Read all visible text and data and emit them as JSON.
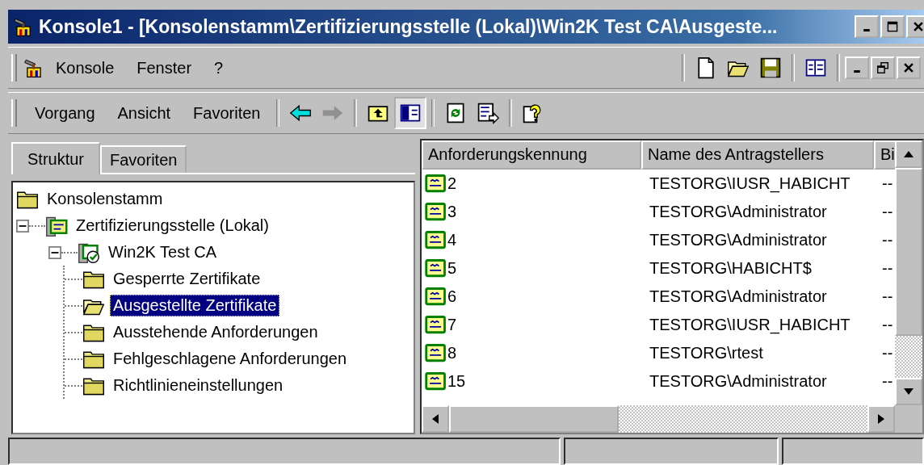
{
  "window": {
    "title": "Konsole1 - [Konsolenstamm\\Zertifizierungsstelle (Lokal)\\Win2K Test CA\\Ausgeste..."
  },
  "menu_bar": {
    "menus": [
      {
        "label": "Konsole"
      },
      {
        "label": "Fenster"
      },
      {
        "label": "?"
      }
    ],
    "tool_groups": [
      [
        {
          "kind": "new"
        },
        {
          "kind": "open"
        },
        {
          "kind": "save"
        }
      ],
      [
        {
          "kind": "panes"
        }
      ]
    ]
  },
  "action_bar": {
    "menus": [
      {
        "label": "Vorgang"
      },
      {
        "label": "Ansicht"
      },
      {
        "label": "Favoriten"
      }
    ],
    "tool_groups": [
      [
        {
          "kind": "back",
          "disabled": false
        },
        {
          "kind": "forward",
          "disabled": true
        }
      ],
      [
        {
          "kind": "up"
        },
        {
          "kind": "show-tree",
          "pressed": true
        }
      ],
      [
        {
          "kind": "refresh"
        },
        {
          "kind": "export"
        }
      ],
      [
        {
          "kind": "help"
        }
      ]
    ]
  },
  "tabs": [
    {
      "label": "Struktur",
      "selected": true
    },
    {
      "label": "Favoriten",
      "selected": false
    }
  ],
  "tree": [
    {
      "label": "Konsolenstamm",
      "kind": "folder",
      "selected": false,
      "children": [
        {
          "label": "Zertifizierungsstelle (Lokal)",
          "kind": "ca-server",
          "selected": false,
          "expanded": true,
          "children": [
            {
              "label": "Win2K Test CA",
              "kind": "ca",
              "selected": false,
              "expanded": true,
              "children": [
                {
                  "label": "Gesperrte Zertifikate",
                  "kind": "folder",
                  "selected": false
                },
                {
                  "label": "Ausgestellte Zertifikate",
                  "kind": "folder",
                  "selected": true
                },
                {
                  "label": "Ausstehende Anforderungen",
                  "kind": "folder",
                  "selected": false
                },
                {
                  "label": "Fehlgeschlagene Anforderungen",
                  "kind": "folder",
                  "selected": false
                },
                {
                  "label": "Richtlinieneinstellungen",
                  "kind": "folder",
                  "selected": false
                }
              ]
            }
          ]
        }
      ]
    }
  ],
  "list": {
    "columns": [
      "Anforderungskennung",
      "Name des Antragstellers",
      "Bi"
    ],
    "rows": [
      {
        "id": "2",
        "name": "TESTORG\\IUSR_HABICHT",
        "column_3": "--"
      },
      {
        "id": "3",
        "name": "TESTORG\\Administrator",
        "column_3": "--"
      },
      {
        "id": "4",
        "name": "TESTORG\\Administrator",
        "column_3": "--"
      },
      {
        "id": "5",
        "name": "TESTORG\\HABICHT$",
        "column_3": "--"
      },
      {
        "id": "6",
        "name": "TESTORG\\Administrator",
        "column_3": "--"
      },
      {
        "id": "7",
        "name": "TESTORG\\IUSR_HABICHT",
        "column_3": "--"
      },
      {
        "id": "8",
        "name": "TESTORG\\rtest",
        "column_3": "--"
      },
      {
        "id": "15",
        "name": "TESTORG\\Administrator",
        "column_3": "--"
      }
    ]
  }
}
